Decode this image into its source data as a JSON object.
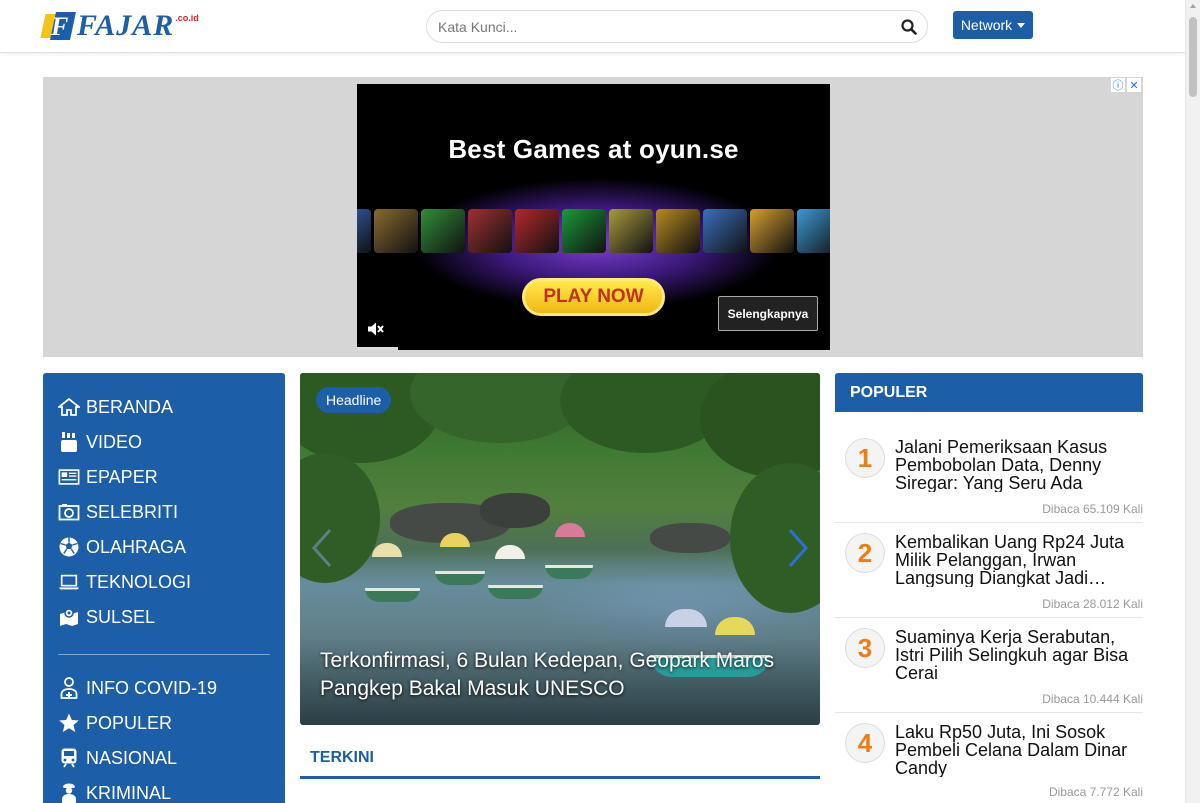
{
  "header": {
    "logo_text": "FAJAR",
    "logo_sub": ".co.id",
    "search_placeholder": "Kata Kunci...",
    "network_label": "Network"
  },
  "ad": {
    "title": "Best Games at oyun.se",
    "play_label": "PLAY NOW",
    "more_label": "Selengkapnya",
    "tile_colors": [
      "#3c6fd1",
      "#8a6a30",
      "#2f8f3a",
      "#a03030",
      "#b5282b",
      "#1a9a3a",
      "#a89a40",
      "#b88a20",
      "#3a6fc0",
      "#d6a030",
      "#3a9ad6"
    ]
  },
  "sidebar": {
    "items": [
      {
        "label": "BERANDA",
        "icon": "home-icon"
      },
      {
        "label": "VIDEO",
        "icon": "youtube-icon"
      },
      {
        "label": "EPAPER",
        "icon": "newspaper-icon"
      },
      {
        "label": "SELEBRITI",
        "icon": "camera-icon"
      },
      {
        "label": "OLAHRAGA",
        "icon": "soccer-ball-icon"
      },
      {
        "label": "TEKNOLOGI",
        "icon": "laptop-icon"
      },
      {
        "label": "SULSEL",
        "icon": "map-icon"
      }
    ],
    "items2": [
      {
        "label": "INFO COVID-19",
        "icon": "medic-icon"
      },
      {
        "label": "POPULER",
        "icon": "star-icon"
      },
      {
        "label": "NASIONAL",
        "icon": "train-icon"
      },
      {
        "label": "KRIMINAL",
        "icon": "criminal-icon"
      }
    ]
  },
  "headline": {
    "badge": "Headline",
    "title": "Terkonfirmasi, 6 Bulan Kedepan, Geopark Maros Pangkep Bakal Masuk UNESCO"
  },
  "terkini": {
    "label": "TERKINI"
  },
  "populer": {
    "label": "POPULER",
    "items": [
      {
        "rank": "1",
        "title": "Jalani Pemeriksaan Kasus Pembobolan Data, Denny Siregar: Yang Seru Ada Nam…",
        "views": "Dibaca 65.109 Kali"
      },
      {
        "rank": "2",
        "title": "Kembalikan Uang Rp24 Juta Milik Pelanggan, Irwan Langsung Diangkat Jadi…",
        "views": "Dibaca 28.012 Kali"
      },
      {
        "rank": "3",
        "title": "Suaminya Kerja Serabutan, Istri Pilih Selingkuh agar Bisa Cerai",
        "views": "Dibaca 10.444 Kali"
      },
      {
        "rank": "4",
        "title": "Laku Rp50 Juta, Ini Sosok Pembeli Celana Dalam Dinar Candy",
        "views": "Dibaca 7.772 Kali"
      }
    ]
  }
}
